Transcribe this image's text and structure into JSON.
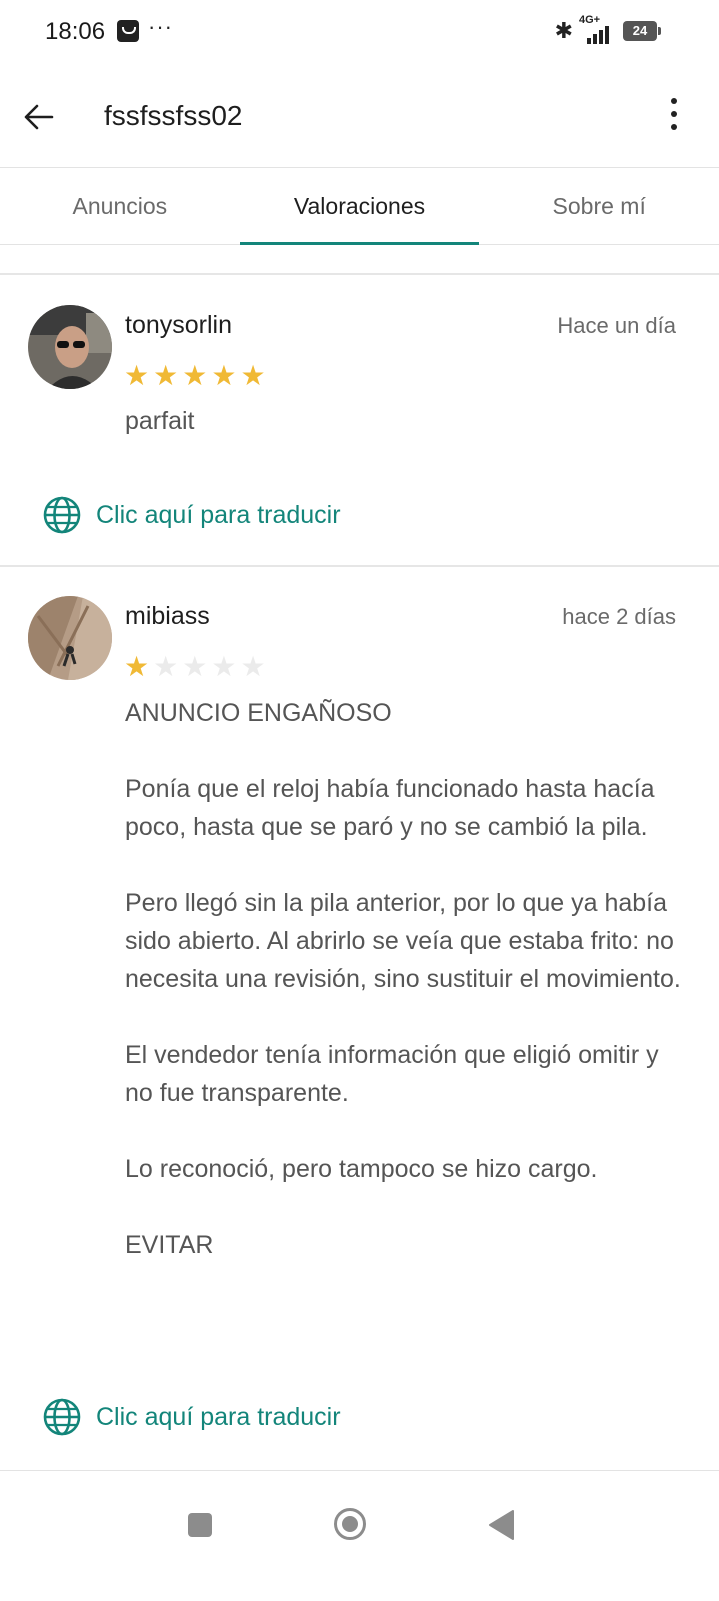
{
  "status_bar": {
    "time": "18:06",
    "overflow": "···",
    "network": "4G+",
    "battery": "24"
  },
  "app_bar": {
    "title": "fssfssfss02"
  },
  "tabs": [
    {
      "label": "Anuncios",
      "active": false
    },
    {
      "label": "Valoraciones",
      "active": true
    },
    {
      "label": "Sobre mí",
      "active": false
    }
  ],
  "reviews": [
    {
      "username": "tonysorlin",
      "time": "Hace un día",
      "rating": 5,
      "paragraphs": [
        "parfait"
      ],
      "translate": "Clic aquí para traducir"
    },
    {
      "username": "mibiass",
      "time": "hace 2 días",
      "rating": 1,
      "paragraphs": [
        "ANUNCIO ENGAÑOSO",
        "Ponía que el reloj había funcionado hasta hacía poco, hasta que se paró y no se cambió la pila.",
        "Pero llegó sin la pila anterior, por lo que ya había sido abierto. Al abrirlo se veía que estaba frito: no necesita una revisión, sino sustituir el movimiento.",
        "El vendedor tenía información que eligió omitir y no fue transparente.",
        "Lo reconoció, pero tampoco se hizo cargo.",
        "EVITAR"
      ],
      "translate": "Clic aquí para traducir"
    }
  ],
  "colors": {
    "accent": "#13857a",
    "star_on": "#f0b935",
    "star_off": "#ebebeb"
  }
}
